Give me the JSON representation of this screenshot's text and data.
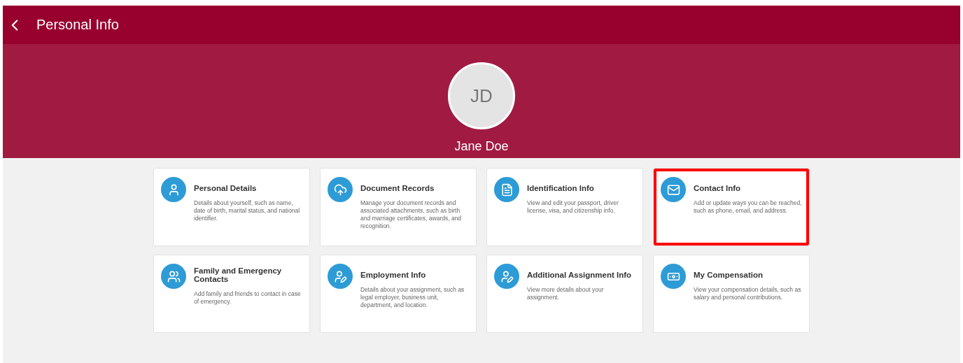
{
  "header": {
    "title": "Personal Info"
  },
  "profile": {
    "initials": "JD",
    "name": "Jane Doe"
  },
  "tiles": [
    {
      "title": "Personal Details",
      "description": "Details about yourself, such as name, date of birth, marital status, and national identifier.",
      "highlighted": false
    },
    {
      "title": "Document Records",
      "description": "Manage your document records and associated attachments, such as birth and marriage certificates, awards, and recognition.",
      "highlighted": false
    },
    {
      "title": "Identification Info",
      "description": "View and edit your passport, driver license, visa, and citizenship info.",
      "highlighted": false
    },
    {
      "title": "Contact Info",
      "description": "Add or update ways you can be reached, such as phone, email, and address.",
      "highlighted": true
    },
    {
      "title": "Family and Emergency Contacts",
      "description": "Add family and friends to contact in case of emergency.",
      "highlighted": false
    },
    {
      "title": "Employment Info",
      "description": "Details about your assignment, such as legal employer, business unit, department, and location.",
      "highlighted": false
    },
    {
      "title": "Additional Assignment Info",
      "description": "View more details about your assignment.",
      "highlighted": false
    },
    {
      "title": "My Compensation",
      "description": "View your compensation details, such as salary and personal contributions.",
      "highlighted": false
    }
  ]
}
